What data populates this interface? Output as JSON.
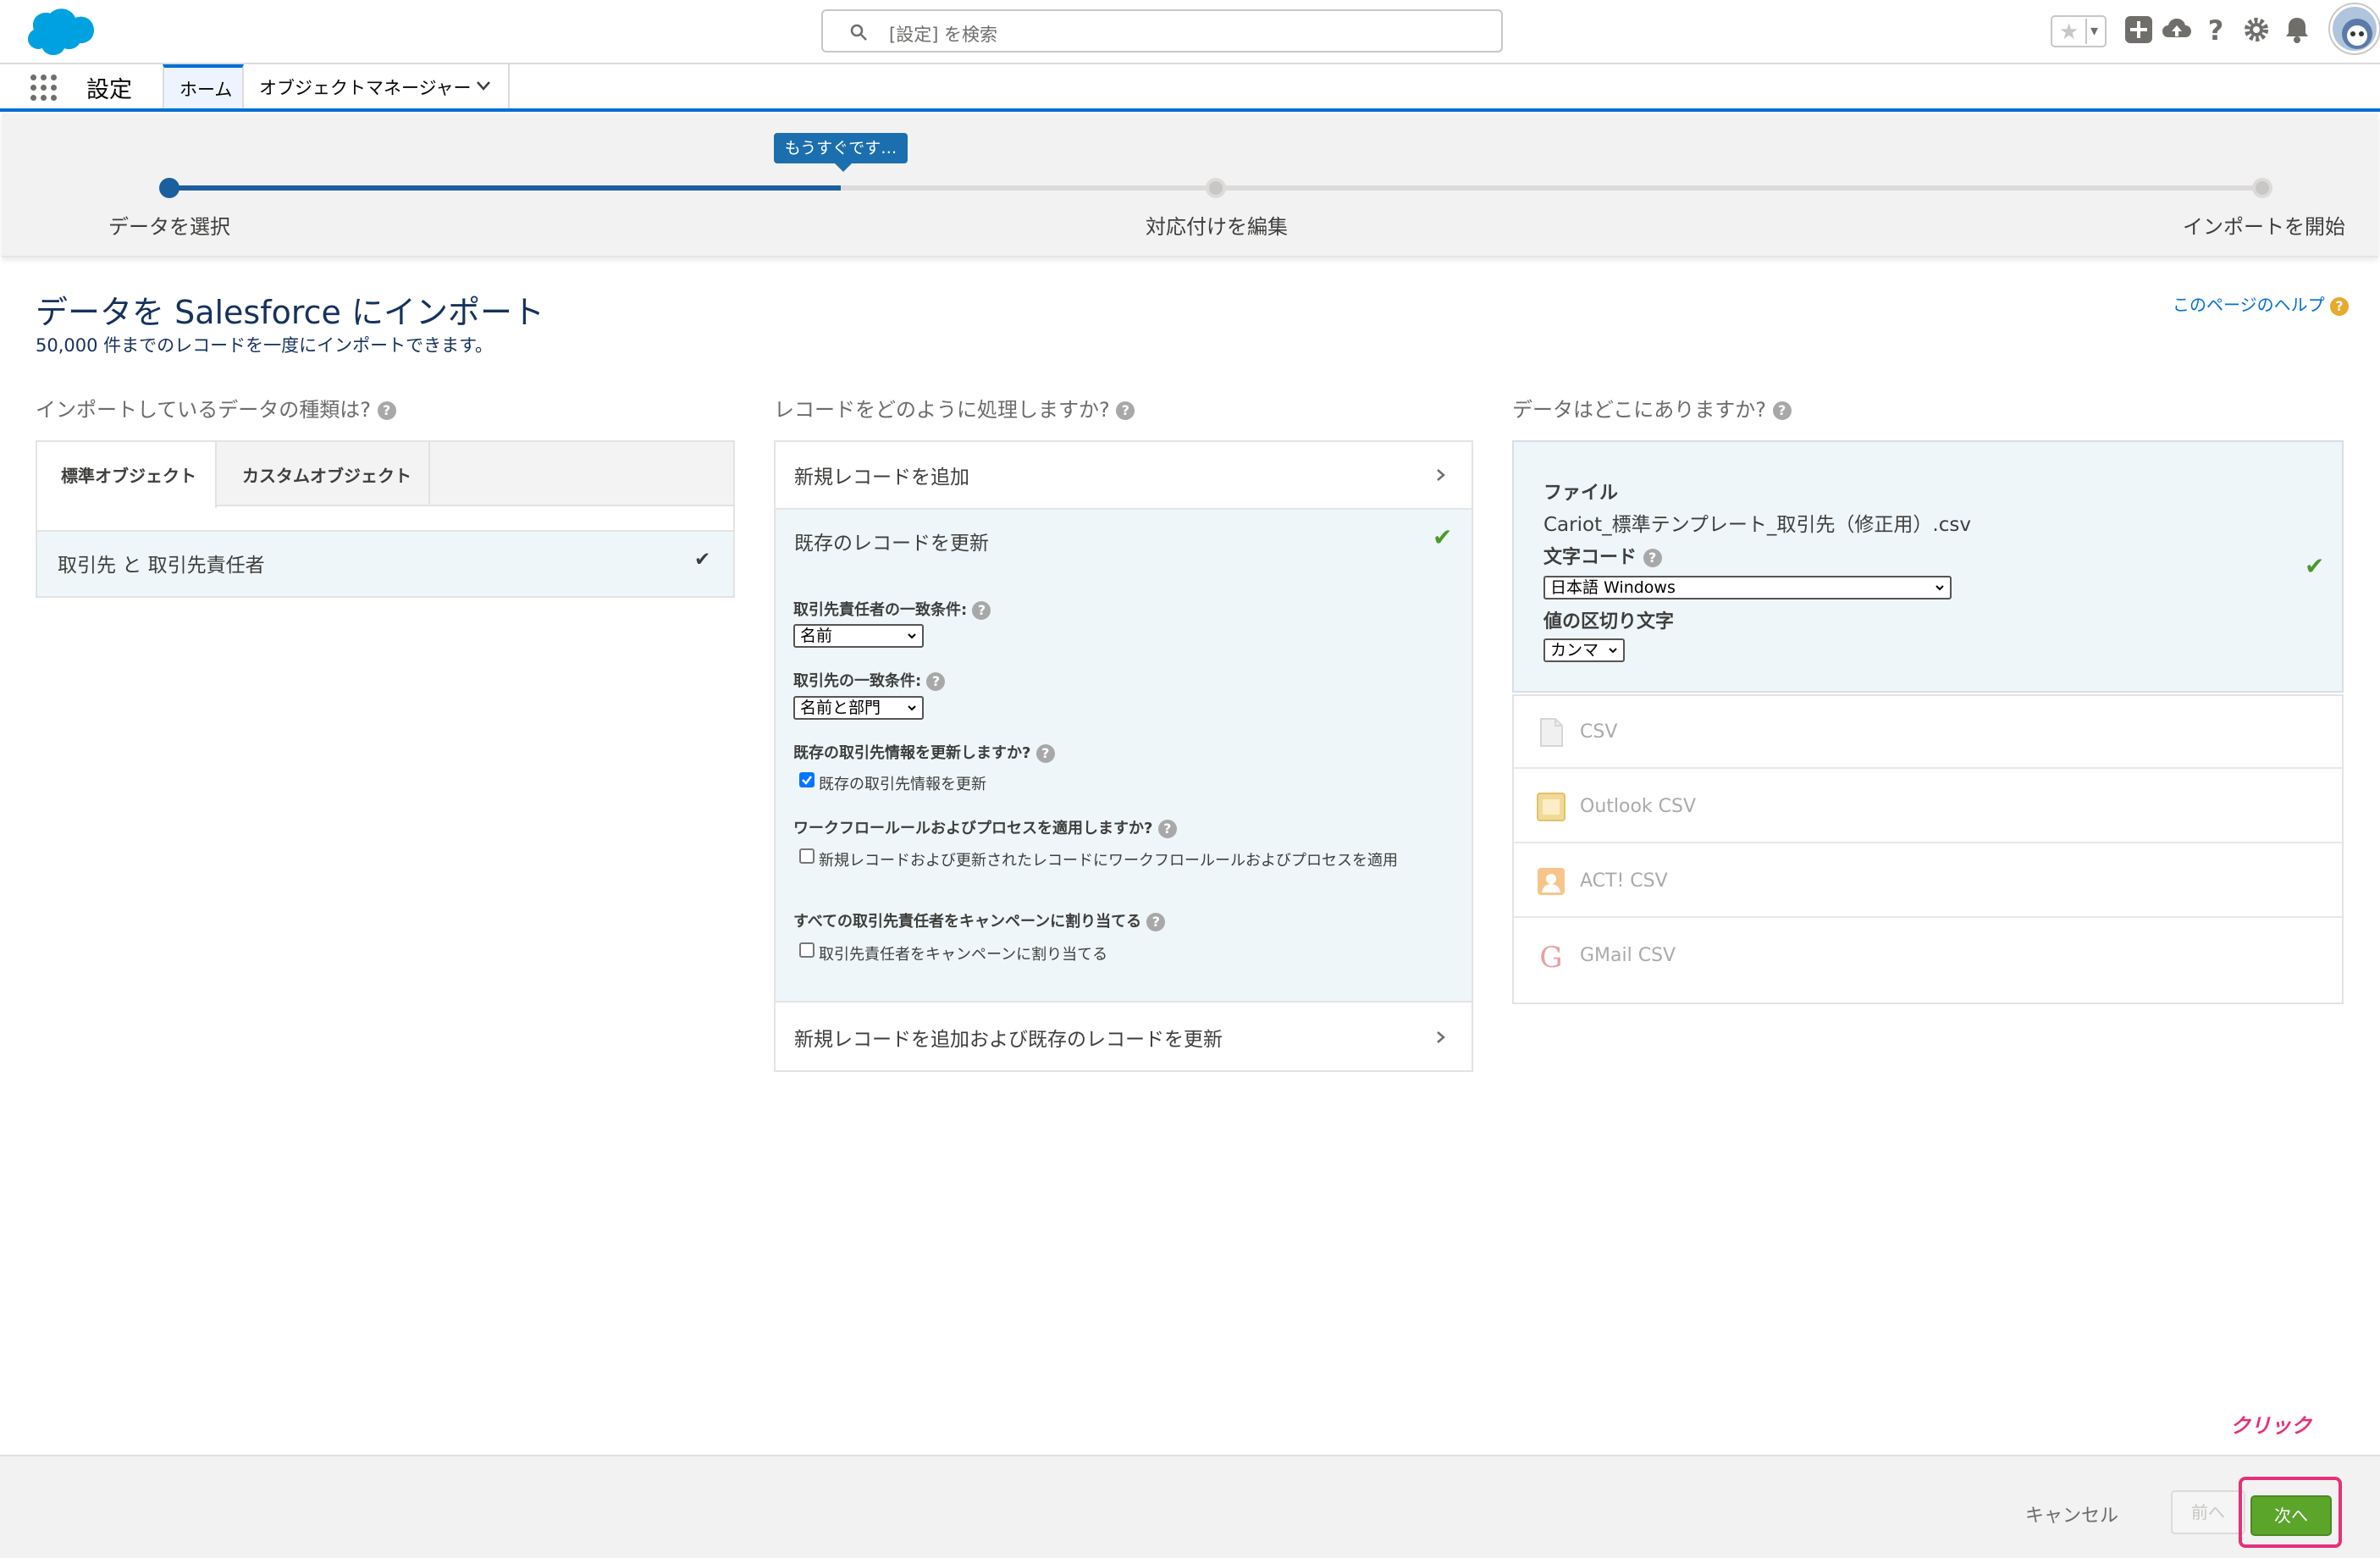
{
  "header": {
    "search_placeholder": "[設定] を検索",
    "icons": [
      "star-icon",
      "add-icon",
      "cloud-icon",
      "help-icon",
      "gear-icon",
      "bell-icon"
    ]
  },
  "nav": {
    "title": "設定",
    "tabs": [
      {
        "label": "ホーム",
        "active": true
      },
      {
        "label": "オブジェクトマネージャー",
        "active": false
      }
    ]
  },
  "progress": {
    "bubble": "もうすぐです…",
    "steps": [
      "データを選択",
      "対応付けを編集",
      "インポートを開始"
    ]
  },
  "page": {
    "title": "データを Salesforce にインポート",
    "subtitle": "50,000 件までのレコードを一度にインポートできます。",
    "help_link": "このページのヘルプ"
  },
  "col1": {
    "heading": "インポートしているデータの種類は?",
    "tabs": [
      "標準オブジェクト",
      "カスタムオブジェクト"
    ],
    "selected_item": "取引先 と 取引先責任者"
  },
  "col2": {
    "heading": "レコードをどのように処理しますか?",
    "option_add": "新規レコードを追加",
    "option_update": "既存のレコードを更新",
    "option_upsert": "新規レコードを追加および既存のレコードを更新",
    "contact_match_label": "取引先責任者の一致条件:",
    "contact_match_value": "名前",
    "account_match_label": "取引先の一致条件:",
    "account_match_value": "名前と部門",
    "update_account_q": "既存の取引先情報を更新しますか?",
    "update_account_cb": "既存の取引先情報を更新",
    "update_account_checked": true,
    "workflow_q": "ワークフロールールおよびプロセスを適用しますか?",
    "workflow_cb": "新規レコードおよび更新されたレコードにワークフロールールおよびプロセスを適用",
    "workflow_checked": false,
    "campaign_q": "すべての取引先責任者をキャンペーンに割り当てる",
    "campaign_cb": "取引先責任者をキャンペーンに割り当てる",
    "campaign_checked": false
  },
  "col3": {
    "heading": "データはどこにありますか?",
    "file_label": "ファイル",
    "file_name": "Cariot_標準テンプレート_取引先（修正用）.csv",
    "encoding_label": "文字コード",
    "encoding_value": "日本語 Windows",
    "delimiter_label": "値の区切り文字",
    "delimiter_value": "カンマ",
    "sources": [
      "CSV",
      "Outlook CSV",
      "ACT! CSV",
      "GMail CSV"
    ]
  },
  "footer": {
    "cancel": "キャンセル",
    "prev": "前へ",
    "next": "次へ",
    "annotation": "クリック"
  },
  "colors": {
    "brand_blue": "#0070d2",
    "progress_blue": "#1b5f9e",
    "next_green": "#5ba52a",
    "highlight_pink": "#e6307a"
  }
}
